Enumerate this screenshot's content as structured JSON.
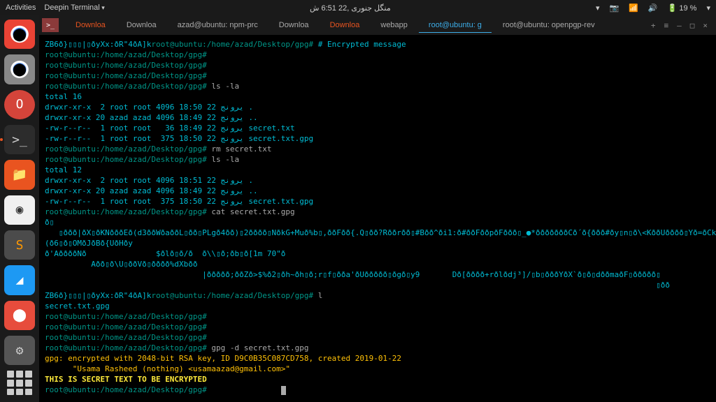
{
  "topbar": {
    "activities": "Activities",
    "app": "Deepin Terminal",
    "datetime": "منگل جنوری ,22  6:51 ش",
    "battery": "19 %"
  },
  "tabs": {
    "t0": "Downloa",
    "t1": "Downloa",
    "t2": "azad@ubuntu: npm-prc",
    "t3": "Downloa",
    "t4": "Downloa",
    "t5": "webapp",
    "t6": "root@ubuntu: g",
    "t7": "root@ubuntu: openpgp-rev"
  },
  "term": {
    "l0a": "ZB6ð}▯▯▯|▯ðyXx:ðR\"4ðA]k",
    "l0b": "root@ubuntu:/home/azad/Desktop/gpg#",
    "l0c": " # Encrypted message",
    "l1": "root@ubuntu:/home/azad/Desktop/gpg#",
    "l2": "root@ubuntu:/home/azad/Desktop/gpg#",
    "l3": "root@ubuntu:/home/azad/Desktop/gpg#",
    "l4a": "root@ubuntu:/home/azad/Desktop/gpg#",
    "l4b": " ls -la",
    "l5": "total 16",
    "l6": "drwxr-xr-x  2 root root 4096 یرونج 22 18:50 .",
    "l7": "drwxr-xr-x 20 azad azad 4096 یرونج 22 18:49 ..",
    "l8": "-rw-r--r--  1 root root   36 یرونج 22 18:49 secret.txt",
    "l9": "-rw-r--r--  1 root root  375 یرونج 22 18:50 secret.txt.gpg",
    "l10a": "root@ubuntu:/home/azad/Desktop/gpg#",
    "l10b": " rm secret.txt",
    "l11a": "root@ubuntu:/home/azad/Desktop/gpg#",
    "l11b": " ls -la",
    "l12": "total 12",
    "l13": "drwxr-xr-x  2 root root 4096 یرونج 22 18:51 .",
    "l14": "drwxr-xr-x 20 azad azad 4096 یرونج 22 18:49 ..",
    "l15": "-rw-r--r--  1 root root  375 یرونج 22 18:50 secret.txt.gpg",
    "l16a": "root@ubuntu:/home/azad/Desktop/gpg#",
    "l16b": " cat secret.txt.gpg",
    "l17": "ð▯",
    "l18": "   ▯ððð|ðX▯ðKNðððEð(d3ððWðaððL▯ðð▯PLgð4ðð)▯2ðððð▯NðkG+Muð%b▯,ððFðð{.Q▯ðð?Rððrðð▯#Bðð^ði1:ð#ððFððpðFððð▯_●*ðððððððCð´ð{ððð#ðy▯n▯ð\\<KððUðððð▯Yð=ðCkð",
    "l19": "(ð6▯ð▯OMðJðBð{UðHðy",
    "l20": "ð'AððððNð               $ðlð▯ð/ð  ð\\\\▯ð;ðb▯ð[1m 70\"ð",
    "l21": "          Aðð▯ð\\U▯ððVð▯ðððð%dXbðð",
    "l22": "                                  |ððððð;ððZð>$%ð2▯ðh~ðh▯ð;r▯f▯ðða'ðUððððð▯ðgð▯y9       Dð[ðððð+rðlðdj³]/▯b▯ðððYðX`ð▯ð▯dððmaðF▯ððððð▯",
    "l23": "                                                                                                                                    ▯ðð",
    "l24a": "ZB6ð}▯▯▯|▯ðyXx:ðR\"4ðA]k",
    "l24b": "root@ubuntu:/home/azad/Desktop/gpg#",
    "l24c": " l",
    "l25": "secret.txt.gpg",
    "l26": "root@ubuntu:/home/azad/Desktop/gpg#",
    "l27": "root@ubuntu:/home/azad/Desktop/gpg#",
    "l28": "root@ubuntu:/home/azad/Desktop/gpg#",
    "l29a": "root@ubuntu:/home/azad/Desktop/gpg#",
    "l29b": " gpg -d secret.txt.gpg",
    "l30": "gpg: encrypted with 2048-bit RSA key, ID D9C0B35C087CD758, created 2019-01-22",
    "l31": "      \"Usama Rasheed (nothing) <usamaazad@gmail.com>\"",
    "l32": "THIS IS SECRET TEXT TO BE ENCRYPTED",
    "l33": "root@ubuntu:/home/azad/Desktop/gpg#"
  }
}
